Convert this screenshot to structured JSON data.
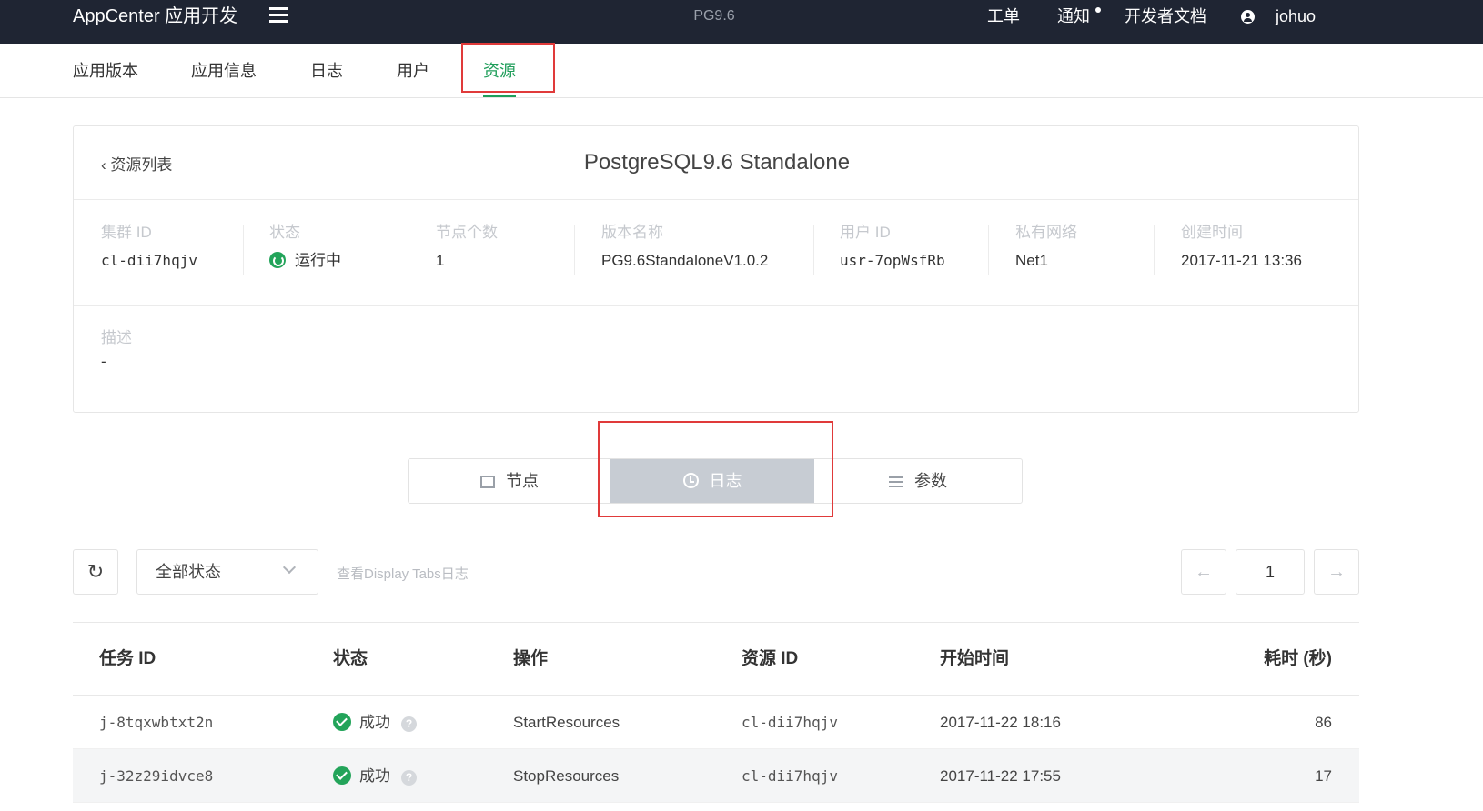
{
  "topbar": {
    "brand": "AppCenter 应用开发",
    "app_name": "PG9.6",
    "nav": [
      "工单",
      "通知",
      "开发者文档"
    ],
    "user": "johuo"
  },
  "subnav": {
    "tabs": [
      "应用版本",
      "应用信息",
      "日志",
      "用户",
      "资源"
    ],
    "active": "资源"
  },
  "detail": {
    "back_label": "资源列表",
    "title": "PostgreSQL9.6 Standalone",
    "fields": [
      {
        "label": "集群 ID",
        "value": "cl-dii7hqjv"
      },
      {
        "label": "状态",
        "value": "运行中"
      },
      {
        "label": "节点个数",
        "value": "1"
      },
      {
        "label": "版本名称",
        "value": "PG9.6StandaloneV1.0.2"
      },
      {
        "label": "用户 ID",
        "value": "usr-7opWsfRb"
      },
      {
        "label": "私有网络",
        "value": "Net1"
      },
      {
        "label": "创建时间",
        "value": "2017-11-21 13:36"
      }
    ],
    "description_label": "描述",
    "description_value": "-"
  },
  "segments": {
    "items": [
      "节点",
      "日志",
      "参数"
    ],
    "active": "日志"
  },
  "toolbar": {
    "status_filter": "全部状态",
    "hint": "查看Display Tabs日志",
    "page": "1",
    "prev_symbol": "←",
    "next_symbol": "→",
    "refresh_symbol": "↻"
  },
  "table": {
    "columns": [
      "任务 ID",
      "状态",
      "操作",
      "资源 ID",
      "开始时间",
      "耗时 (秒)"
    ],
    "rows": [
      {
        "task_id": "j-8tqxwbtxt2n",
        "status": "成功",
        "action": "StartResources",
        "resource_id": "cl-dii7hqjv",
        "start_time": "2017-11-22 18:16",
        "duration": "86"
      },
      {
        "task_id": "j-32z29idvce8",
        "status": "成功",
        "action": "StopResources",
        "resource_id": "cl-dii7hqjv",
        "start_time": "2017-11-22 17:55",
        "duration": "17"
      }
    ]
  },
  "colors": {
    "topbar_bg": "#1f2533",
    "accent_green": "#1f9e5a",
    "success": "#23a45a",
    "highlight_red": "#e03a3a",
    "segment_active_bg": "#c7ccd3"
  }
}
